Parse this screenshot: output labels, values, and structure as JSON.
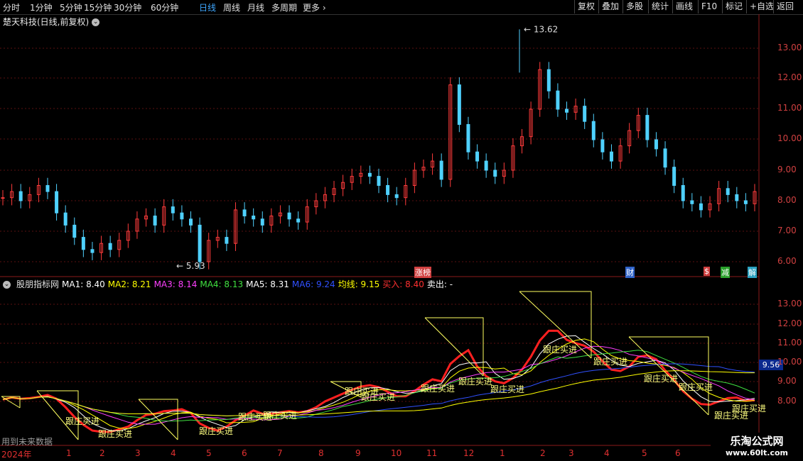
{
  "toolbar": {
    "periods": [
      "分时",
      "1分钟",
      "5分钟",
      "15分钟",
      "30分钟",
      "60分钟",
      "日线",
      "周线",
      "月线",
      "多周期",
      "更多"
    ],
    "active_period": "日线",
    "right_buttons": [
      "复权",
      "叠加",
      "多股",
      "统计",
      "画线",
      "F10",
      "标记",
      "+自选",
      "返回"
    ]
  },
  "header": {
    "title": "楚天科技(日线,前复权)"
  },
  "price_axis": [
    "13.00",
    "12.00",
    "11.00",
    "10.00",
    "9.00",
    "8.00",
    "7.00",
    "6.00"
  ],
  "markers": {
    "high": "13.62",
    "low": "5.93"
  },
  "events": [
    {
      "label": "涨榜",
      "color": "#d04040"
    },
    {
      "label": "财",
      "color": "#2f62c8"
    },
    {
      "label": "$",
      "color": "#d04040"
    },
    {
      "label": "减",
      "color": "#2aa02a"
    },
    {
      "label": "解",
      "color": "#2aa0c0"
    }
  ],
  "indicator": {
    "name": "股朋指标网",
    "items": [
      {
        "text": "MA1: 8.40",
        "color": "#ffffff"
      },
      {
        "text": "MA2: 8.21",
        "color": "#ffff00"
      },
      {
        "text": "MA3: 8.14",
        "color": "#ff40ff"
      },
      {
        "text": "MA4: 8.13",
        "color": "#40e040"
      },
      {
        "text": "MA5: 8.31",
        "color": "#ffffff"
      },
      {
        "text": "MA6: 9.24",
        "color": "#3050ff"
      },
      {
        "text": "均线: 9.15",
        "color": "#ffff00"
      },
      {
        "text": "买入: 8.40",
        "color": "#ff3030"
      },
      {
        "text": "卖出: -",
        "color": "#ffffff"
      }
    ],
    "axis": [
      "13.00",
      "12.00",
      "11.00",
      "10.00",
      "9.00",
      "8.00"
    ],
    "last_value": "9.56",
    "signal_label": "跟庄买进"
  },
  "footer": {
    "note": "用到未来数据",
    "year": "2024年",
    "months": [
      "1",
      "2",
      "3",
      "4",
      "5",
      "6",
      "7",
      "8",
      "9",
      "10",
      "11",
      "12",
      "1",
      "2",
      "3",
      "4",
      "5",
      "6"
    ]
  },
  "logo": {
    "line1": "乐淘公式网",
    "line2": "www.60lt.com"
  },
  "chart_data": {
    "type": "candlestick",
    "series": [
      {
        "name": "楚天科技",
        "close": [
          8.1,
          8.3,
          8.0,
          8.2,
          8.5,
          8.3,
          7.6,
          7.2,
          6.8,
          6.4,
          6.3,
          6.6,
          6.4,
          6.7,
          7.0,
          7.4,
          7.5,
          7.2,
          7.8,
          7.6,
          7.4,
          7.2,
          6.0,
          6.7,
          6.8,
          6.6,
          7.7,
          7.5,
          7.4,
          7.2,
          7.5,
          7.6,
          7.4,
          7.3,
          7.8,
          8.0,
          8.2,
          8.4,
          8.6,
          8.8,
          8.9,
          8.8,
          8.5,
          8.2,
          8.1,
          8.5,
          9.0,
          9.1,
          9.3,
          8.7,
          11.8,
          10.5,
          9.6,
          9.3,
          9.0,
          8.8,
          9.0,
          9.8,
          10.1,
          11.0,
          12.3,
          11.6,
          11.0,
          10.9,
          11.1,
          10.6,
          10.0,
          9.6,
          9.3,
          9.8,
          10.3,
          10.8,
          10.0,
          9.7,
          9.1,
          8.5,
          8.0,
          7.9,
          7.7,
          7.9,
          8.4,
          8.2,
          8.0,
          7.9,
          8.3
        ]
      }
    ],
    "ylim": [
      5.9,
      13.62
    ],
    "high": 13.62,
    "low": 5.93
  }
}
